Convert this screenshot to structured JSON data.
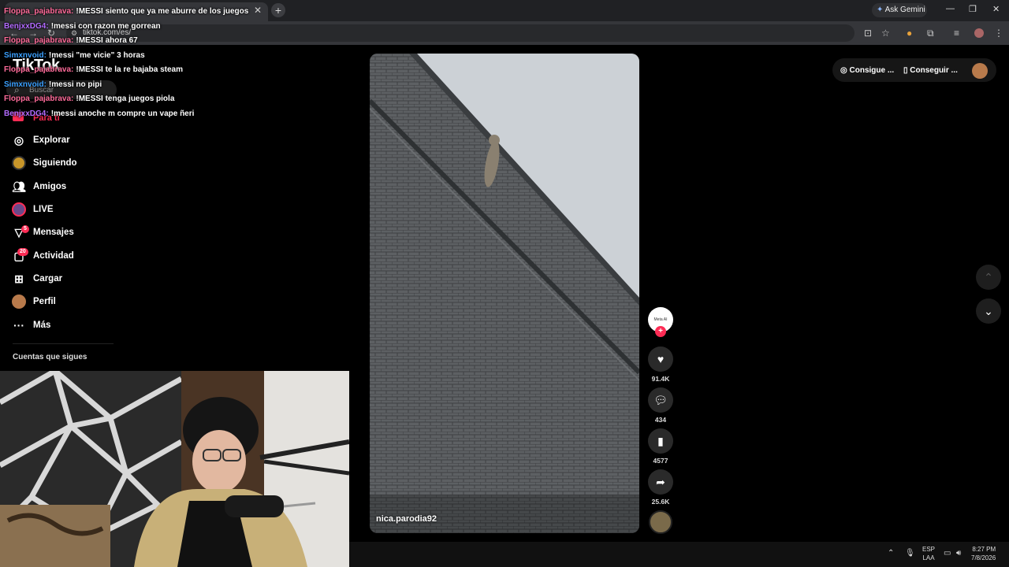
{
  "browser": {
    "tab_title": "TikTok",
    "url": "tiktok.com/es/",
    "ask_gemini": "Ask Gemini",
    "new_tab": "+",
    "tab_close": "✕",
    "win_min": "—",
    "win_max": "❐",
    "win_close": "✕"
  },
  "chat": [
    {
      "user": "Floppa_pajabrava:",
      "msg": "!MESSI siento que ya me aburre de los juegos",
      "color": "#ff6b9a"
    },
    {
      "user": "BenjxxDG4:",
      "msg": "!messi con razon me gorrean",
      "color": "#b36bff"
    },
    {
      "user": "Floppa_pajabrava:",
      "msg": "!MESSI ahora 67",
      "color": "#ff6b9a"
    },
    {
      "user": "Simxnvoid:",
      "msg": "!messi \"me vicie\" 3 horas",
      "color": "#3aa0ff"
    },
    {
      "user": "Floppa_pajabrava:",
      "msg": "!MESSI te la re bajaba steam",
      "color": "#ff6b9a"
    },
    {
      "user": "Simxnvoid:",
      "msg": "!messi no pipi",
      "color": "#3aa0ff"
    },
    {
      "user": "Floppa_pajabrava:",
      "msg": "!MESSI tenga juegos piola",
      "color": "#ff6b9a"
    },
    {
      "user": "BenjxxDG4:",
      "msg": "!messi anoche m compre un vape ñeri",
      "color": "#b36bff"
    }
  ],
  "sidebar": {
    "logo": "TikTok",
    "search_placeholder": "Buscar",
    "items": [
      {
        "label": "Explorar",
        "icon": "compass-icon"
      },
      {
        "label": "Siguiendo",
        "icon": "following-avatar-icon"
      },
      {
        "label": "Amigos",
        "icon": "friends-icon"
      },
      {
        "label": "LIVE",
        "icon": "live-avatar-icon"
      },
      {
        "label": "Mensajes",
        "icon": "messages-icon",
        "badge": "5"
      },
      {
        "label": "Actividad",
        "icon": "activity-icon",
        "badge": "20"
      },
      {
        "label": "Cargar",
        "icon": "upload-icon"
      },
      {
        "label": "Perfil",
        "icon": "profile-avatar-icon"
      },
      {
        "label": "Más",
        "icon": "more-icon"
      }
    ],
    "following_header": "Cuentas que sigues",
    "for_you_partial": "Para ti"
  },
  "video": {
    "author": "nica.parodia92",
    "meta_label": "Meta AI",
    "likes": "91.4K",
    "comments": "434",
    "saves": "4577",
    "shares": "25.6K"
  },
  "topright": {
    "btn1": "Consigue ...",
    "btn2": "Conseguir ..."
  },
  "taskbar": {
    "lang1": "ESP",
    "lang2": "LAA",
    "time": "8:27 PM",
    "date": "7/8/2026"
  }
}
